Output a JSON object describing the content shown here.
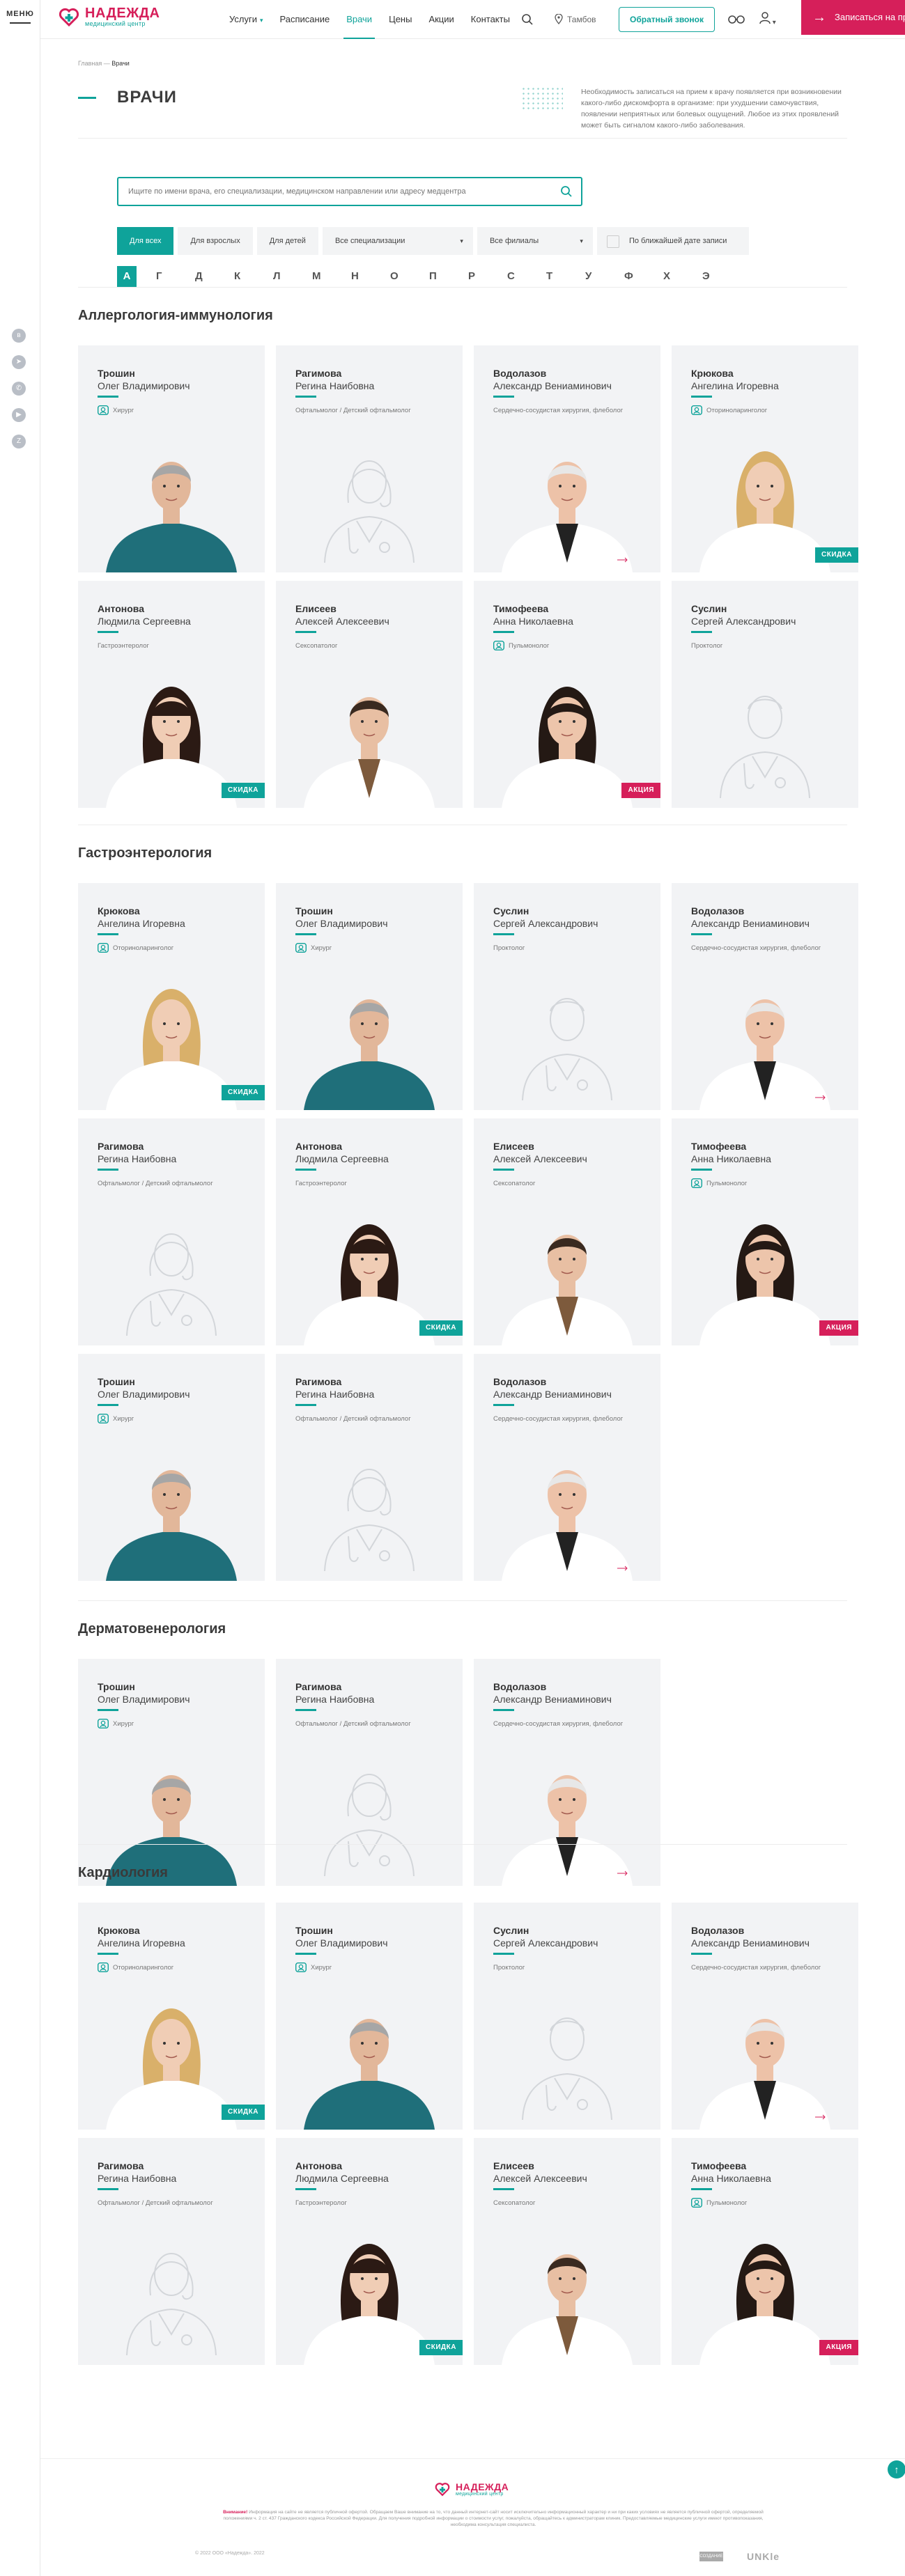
{
  "rail": {
    "menu_label": "МЕНЮ"
  },
  "header": {
    "logo_name": "НАДЕЖДА",
    "logo_sub": "медицинский центр",
    "nav": [
      "Услуги",
      "Расписание",
      "Врачи",
      "Цены",
      "Акции",
      "Контакты"
    ],
    "active_nav": "Врачи",
    "city": "Тамбов",
    "callback_label": "Обратный звонок",
    "enroll_label": "Записаться на прием"
  },
  "breadcrumbs": {
    "home": "Главная",
    "separator": "—",
    "current": "Врачи"
  },
  "page": {
    "title": "ВРАЧИ",
    "lead": "Необходимость записаться на прием к врачу появляется при возникновении какого-либо дискомфорта в организме: при ухудшении самочувствия, появлении неприятных или болевых ощущений. Любое из этих проявлений может быть сигналом какого-либо заболевания."
  },
  "search": {
    "placeholder": "Ищите по имени врача, его специализации, медицинском направлении или адресу медцентра"
  },
  "filters": {
    "all": "Для всех",
    "adults": "Для взрослых",
    "kids": "Для детей",
    "specialization": "Все специализации",
    "branches": "Все филиалы",
    "nearest": "По ближайшей дате записи"
  },
  "letters": [
    "А",
    "Г",
    "Д",
    "К",
    "Л",
    "М",
    "Н",
    "О",
    "П",
    "Р",
    "С",
    "Т",
    "У",
    "Ф",
    "Х",
    "Э"
  ],
  "active_letter": "А",
  "badges": {
    "sale": "СКИДКА",
    "promo": "АКЦИЯ"
  },
  "sections": [
    {
      "title": "Аллергология-иммунология",
      "doctors": [
        {
          "last": "Трошин",
          "first": "Олег Владимирович",
          "spec": "Хирург",
          "kid": true,
          "photo": "man-scrubs",
          "badge": ""
        },
        {
          "last": "Рагимова",
          "first": "Регина Наибовна",
          "spec": "Офтальмолог / Детский офтальмолог",
          "kid": false,
          "photo": "placeholder-woman",
          "badge": ""
        },
        {
          "last": "Водолазов",
          "first": "Александр Вениаминович",
          "spec": "Сердечно-сосудистая хирургия, флеболог",
          "kid": false,
          "photo": "old-man",
          "badge": ""
        },
        {
          "last": "Крюкова",
          "first": "Ангелина Игоревна",
          "spec": "Оториноларинголог",
          "kid": true,
          "photo": "blonde-woman",
          "badge": "sale"
        },
        {
          "last": "Антонова",
          "first": "Людмила Сергеевна",
          "spec": "Гастроэнтеролог",
          "kid": false,
          "photo": "brunette-bangs",
          "badge": "sale"
        },
        {
          "last": "Елисеев",
          "first": "Алексей Алексеевич",
          "spec": "Сексопатолог",
          "kid": false,
          "photo": "man-tie",
          "badge": ""
        },
        {
          "last": "Тимофеева",
          "first": "Анна Николаевна",
          "spec": "Пульмонолог",
          "kid": true,
          "photo": "dark-curly-woman",
          "badge": "promo"
        },
        {
          "last": "Суслин",
          "first": "Сергей Александрович",
          "spec": "Проктолог",
          "kid": false,
          "photo": "placeholder-man",
          "badge": ""
        }
      ]
    },
    {
      "title": "Гастроэнтерология",
      "doctors": [
        {
          "last": "Крюкова",
          "first": "Ангелина Игоревна",
          "spec": "Оториноларинголог",
          "kid": true,
          "photo": "blonde-woman",
          "badge": "sale"
        },
        {
          "last": "Трошин",
          "first": "Олег Владимирович",
          "spec": "Хирург",
          "kid": true,
          "photo": "man-scrubs",
          "badge": ""
        },
        {
          "last": "Суслин",
          "first": "Сергей Александрович",
          "spec": "Проктолог",
          "kid": false,
          "photo": "placeholder-man",
          "badge": ""
        },
        {
          "last": "Водолазов",
          "first": "Александр Вениаминович",
          "spec": "Сердечно-сосудистая хирургия, флеболог",
          "kid": false,
          "photo": "old-man",
          "badge": ""
        },
        {
          "last": "Рагимова",
          "first": "Регина Наибовна",
          "spec": "Офтальмолог / Детский офтальмолог",
          "kid": false,
          "photo": "placeholder-woman",
          "badge": ""
        },
        {
          "last": "Антонова",
          "first": "Людмила Сергеевна",
          "spec": "Гастроэнтеролог",
          "kid": false,
          "photo": "brunette-bangs",
          "badge": "sale"
        },
        {
          "last": "Елисеев",
          "first": "Алексей Алексеевич",
          "spec": "Сексопатолог",
          "kid": false,
          "photo": "man-tie",
          "badge": ""
        },
        {
          "last": "Тимофеева",
          "first": "Анна Николаевна",
          "spec": "Пульмонолог",
          "kid": true,
          "photo": "dark-curly-woman",
          "badge": "promo"
        },
        {
          "last": "Трошин",
          "first": "Олег Владимирович",
          "spec": "Хирург",
          "kid": true,
          "photo": "man-scrubs",
          "badge": ""
        },
        {
          "last": "Рагимова",
          "first": "Регина Наибовна",
          "spec": "Офтальмолог / Детский офтальмолог",
          "kid": false,
          "photo": "placeholder-woman",
          "badge": ""
        },
        {
          "last": "Водолазов",
          "first": "Александр Вениаминович",
          "spec": "Сердечно-сосудистая хирургия, флеболог",
          "kid": false,
          "photo": "old-man",
          "badge": ""
        }
      ]
    },
    {
      "title": "Дерматовенерология",
      "doctors": [
        {
          "last": "Трошин",
          "first": "Олег Владимирович",
          "spec": "Хирург",
          "kid": true,
          "photo": "man-scrubs",
          "badge": ""
        },
        {
          "last": "Рагимова",
          "first": "Регина Наибовна",
          "spec": "Офтальмолог / Детский офтальмолог",
          "kid": false,
          "photo": "placeholder-woman",
          "badge": ""
        },
        {
          "last": "Водолазов",
          "first": "Александр Вениаминович",
          "spec": "Сердечно-сосудистая хирургия, флеболог",
          "kid": false,
          "photo": "old-man",
          "badge": ""
        }
      ]
    },
    {
      "title": "Кардиология",
      "doctors": [
        {
          "last": "Крюкова",
          "first": "Ангелина Игоревна",
          "spec": "Оториноларинголог",
          "kid": true,
          "photo": "blonde-woman",
          "badge": "sale"
        },
        {
          "last": "Трошин",
          "first": "Олег Владимирович",
          "spec": "Хирург",
          "kid": true,
          "photo": "man-scrubs",
          "badge": ""
        },
        {
          "last": "Суслин",
          "first": "Сергей Александрович",
          "spec": "Проктолог",
          "kid": false,
          "photo": "placeholder-man",
          "badge": ""
        },
        {
          "last": "Водолазов",
          "first": "Александр Вениаминович",
          "spec": "Сердечно-сосудистая хирургия, флеболог",
          "kid": false,
          "photo": "old-man",
          "badge": ""
        },
        {
          "last": "Рагимова",
          "first": "Регина Наибовна",
          "spec": "Офтальмолог / Детский офтальмолог",
          "kid": false,
          "photo": "placeholder-woman",
          "badge": ""
        },
        {
          "last": "Антонова",
          "first": "Людмила Сергеевна",
          "spec": "Гастроэнтеролог",
          "kid": false,
          "photo": "brunette-bangs",
          "badge": "sale"
        },
        {
          "last": "Елисеев",
          "first": "Алексей Алексеевич",
          "spec": "Сексопатолог",
          "kid": false,
          "photo": "man-tie",
          "badge": ""
        },
        {
          "last": "Тимофеева",
          "first": "Анна Николаевна",
          "spec": "Пульмонолог",
          "kid": true,
          "photo": "dark-curly-woman",
          "badge": "promo"
        }
      ]
    }
  ],
  "footer": {
    "logo_name": "НАДЕЖДА",
    "logo_sub": "медицинский центр",
    "disclaimer_lead": "Внимание!",
    "disclaimer": "Информация на сайте не является публичной офертой. Обращаем Ваше внимание на то, что данный интернет-сайт носит исключительно информационный характер и ни при каких условиях не является публичной офертой, определяемой положениями ч. 2 ст. 437 Гражданского кодекса Российской Федерации. Для получения подробной информации о стоимости услуг, пожалуйста, обращайтесь к администраторам клиник. Предоставляемые медицинские услуги имеют противопоказания, необходима консультация специалиста.",
    "copyright": "© 2022 ООО «Надежда». 2022",
    "dev_badge": "СОЗДАНИЕ",
    "dev_name": "UNKle"
  },
  "colors": {
    "accent": "#0fa39a",
    "brand": "#d61f5a",
    "card_bg": "#f2f3f5"
  }
}
